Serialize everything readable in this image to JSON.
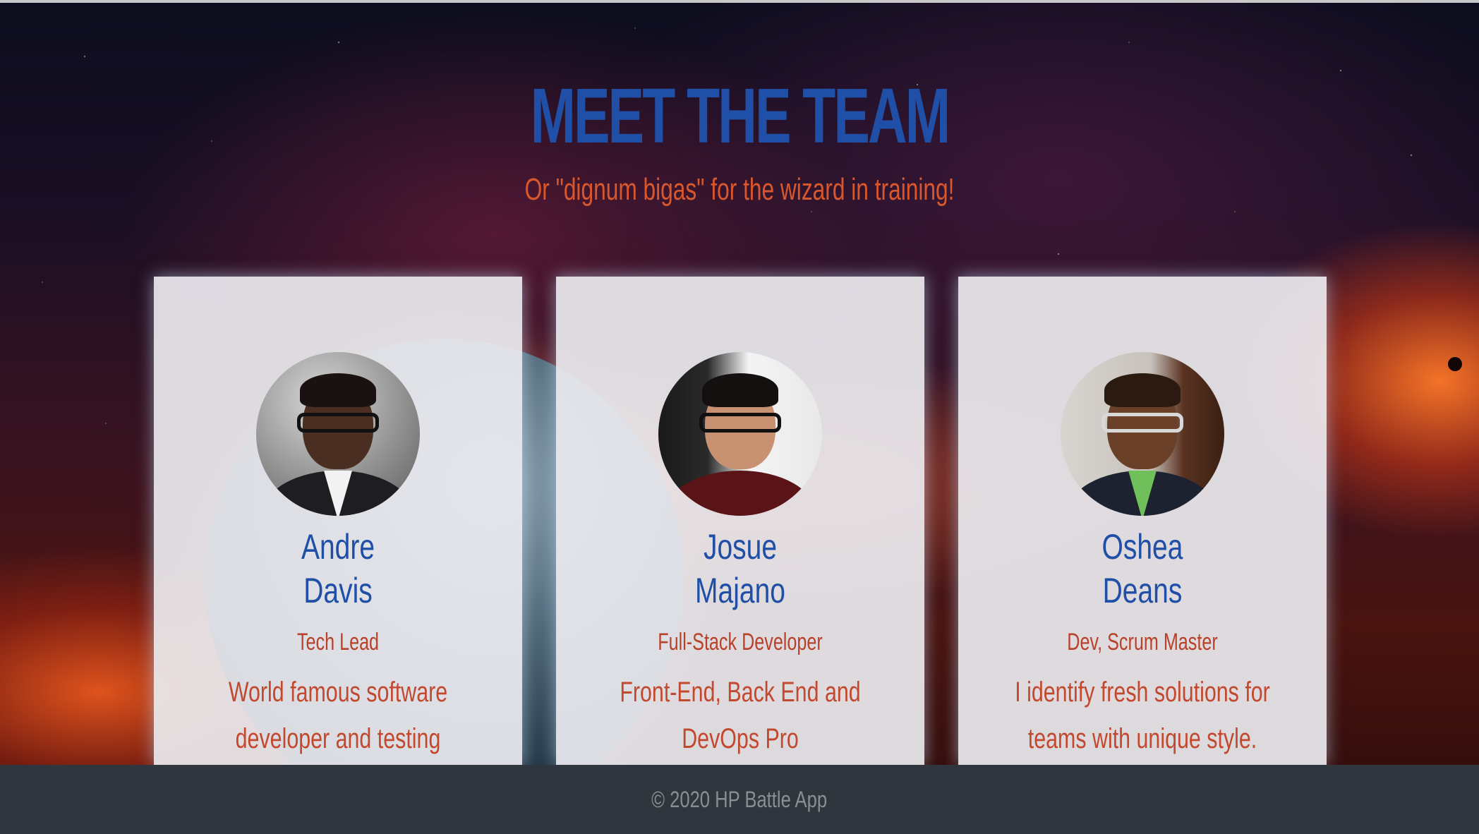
{
  "header": {
    "title": "MEET THE TEAM",
    "subtitle": "Or \"dignum bigas\" for the wizard in training!"
  },
  "team": [
    {
      "first_name": "Andre",
      "last_name": "Davis",
      "role": "Tech Lead",
      "bio": "World famous software developer and testing expert."
    },
    {
      "first_name": "Josue",
      "last_name": "Majano",
      "role": "Full-Stack Developer",
      "bio": "Front-End, Back End and DevOps Pro"
    },
    {
      "first_name": "Oshea",
      "last_name": "Deans",
      "role": "Dev, Scrum Master",
      "bio": "I identify fresh solutions for teams with unique style."
    }
  ],
  "footer": {
    "copyright": "© 2020 HP Battle App"
  },
  "colors": {
    "title": "#1f4fa6",
    "subtitle": "#d9572c",
    "footer_bg": "#30363e"
  }
}
